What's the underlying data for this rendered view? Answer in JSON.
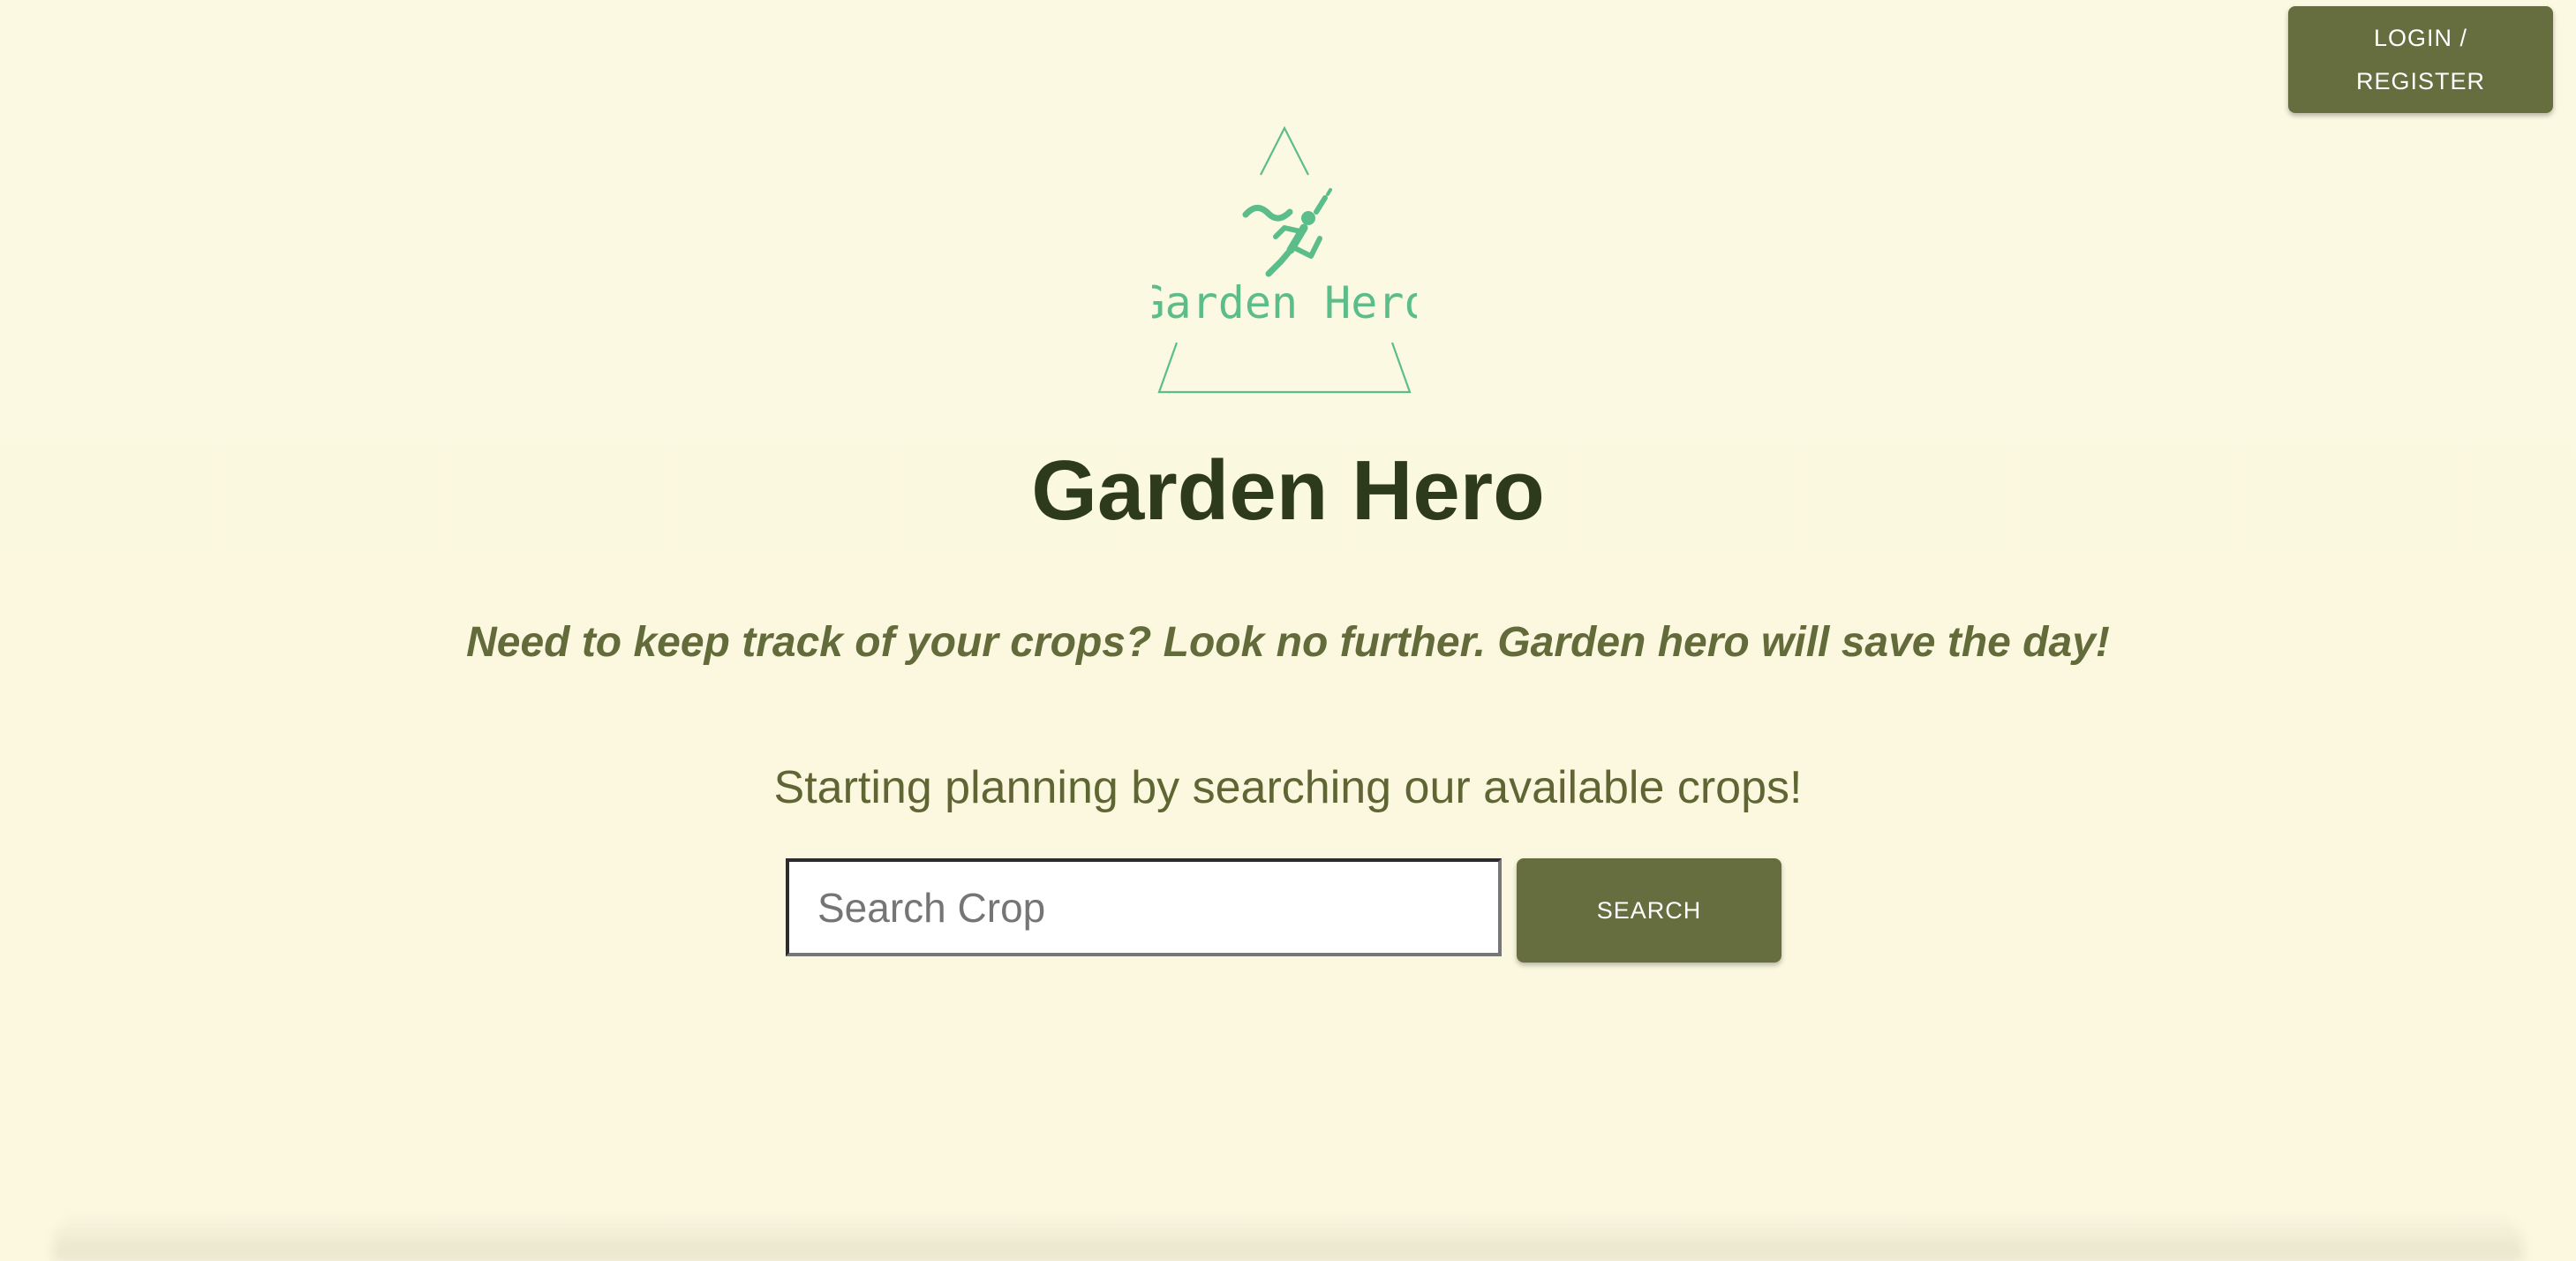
{
  "header": {
    "login_line1": "LOGIN /",
    "login_line2": "REGISTER"
  },
  "logo": {
    "text": "Garden Hero",
    "icon": "running-person-icon",
    "color": "#5bbd8a"
  },
  "hero": {
    "title": "Garden Hero",
    "tagline": "Need to keep track of your crops? Look no further. Garden hero will save the day!",
    "prompt": "Starting planning by searching our available crops!"
  },
  "search": {
    "placeholder": "Search Crop",
    "value": "",
    "button_label": "SEARCH"
  },
  "colors": {
    "background": "#fbf9e1",
    "accent": "#666d3e",
    "title": "#2d3a1c",
    "text": "#646b3a",
    "logo": "#5bbd8a"
  }
}
